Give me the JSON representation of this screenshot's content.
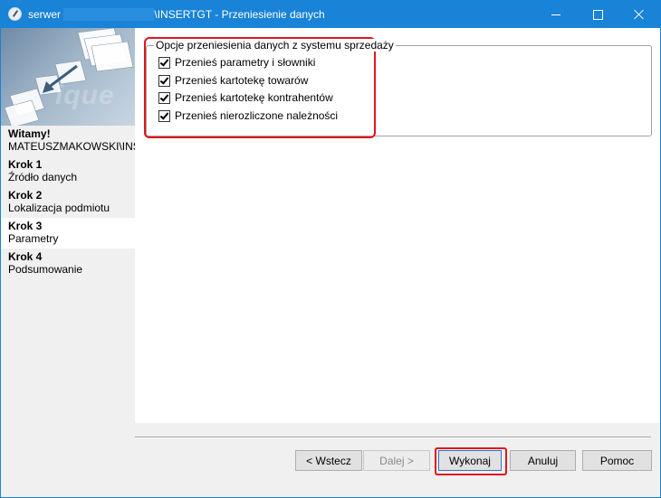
{
  "window": {
    "title_prefix": "serwer",
    "title_suffix": "\\INSERTGT - Przeniesienie danych"
  },
  "banner": {
    "text": "ique"
  },
  "sidebar": {
    "welcome": {
      "title": "Witamy!",
      "subtitle": "MATEUSZMAKOWSKI\\INSE"
    },
    "steps": [
      {
        "title": "Krok 1",
        "subtitle": "Źródło danych",
        "active": false
      },
      {
        "title": "Krok 2",
        "subtitle": "Lokalizacja podmiotu",
        "active": false
      },
      {
        "title": "Krok 3",
        "subtitle": "Parametry",
        "active": true
      },
      {
        "title": "Krok 4",
        "subtitle": "Podsumowanie",
        "active": false
      }
    ]
  },
  "options": {
    "group_label": "Opcje przeniesienia danych z systemu sprzedaży",
    "items": [
      {
        "label": "Przenieś parametry i słowniki",
        "checked": true
      },
      {
        "label": "Przenieś kartotekę towarów",
        "checked": true
      },
      {
        "label": "Przenieś kartotekę kontrahentów",
        "checked": true
      },
      {
        "label": "Przenieś nierozliczone należności",
        "checked": true
      }
    ]
  },
  "buttons": {
    "back": "< Wstecz",
    "next": "Dalej >",
    "run": "Wykonaj",
    "cancel": "Anuluj",
    "help": "Pomoc"
  },
  "colors": {
    "titlebar": "#1883d7",
    "highlight": "#e0161b",
    "active_step": "#ffffff"
  }
}
